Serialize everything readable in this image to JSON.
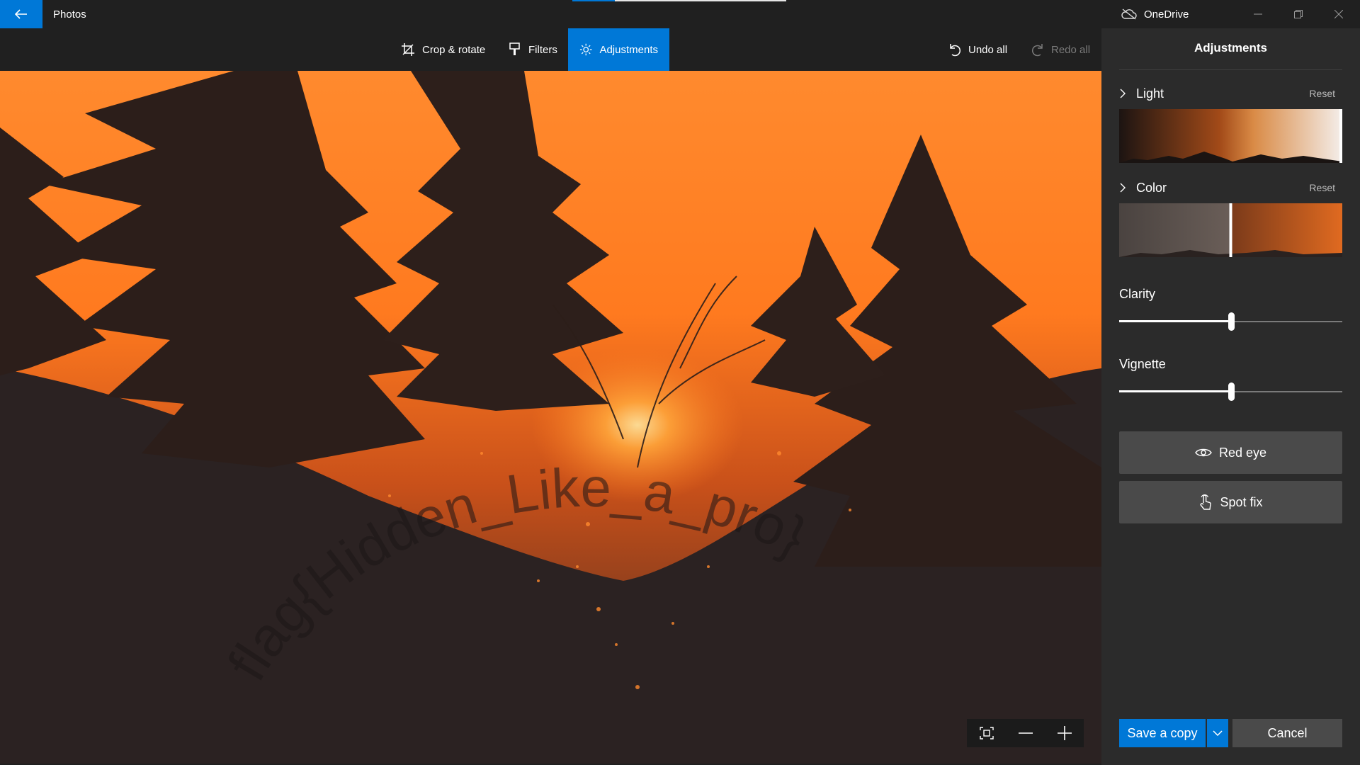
{
  "app": {
    "title": "Photos"
  },
  "titlebar": {
    "onedrive_label": "OneDrive",
    "icons": [
      "back-arrow-icon",
      "onedrive-cloud-icon",
      "minimize-icon",
      "restore-icon",
      "close-icon"
    ]
  },
  "toolbar": {
    "tabs": [
      {
        "label": "Crop & rotate",
        "icon": "crop-icon",
        "active": false
      },
      {
        "label": "Filters",
        "icon": "filters-brush-icon",
        "active": false
      },
      {
        "label": "Adjustments",
        "icon": "sun-icon",
        "active": true
      }
    ],
    "undo_all": "Undo all",
    "redo_all": "Redo all",
    "accent": "#0078d7"
  },
  "photo": {
    "watermark": "flag{Hidden_Like_a_pro}"
  },
  "zoom": {
    "icons": [
      "fit-to-window-icon",
      "zoom-out-icon",
      "zoom-in-icon"
    ]
  },
  "panel": {
    "title": "Adjustments",
    "light": {
      "label": "Light",
      "reset": "Reset",
      "level": 1.0
    },
    "color": {
      "label": "Color",
      "reset": "Reset",
      "level": 0.5
    },
    "clarity": {
      "label": "Clarity",
      "value": 0.5
    },
    "vignette": {
      "label": "Vignette",
      "value": 0.5
    },
    "red_eye": "Red eye",
    "spot_fix": "Spot fix"
  },
  "footer": {
    "save": "Save a copy",
    "cancel": "Cancel"
  }
}
